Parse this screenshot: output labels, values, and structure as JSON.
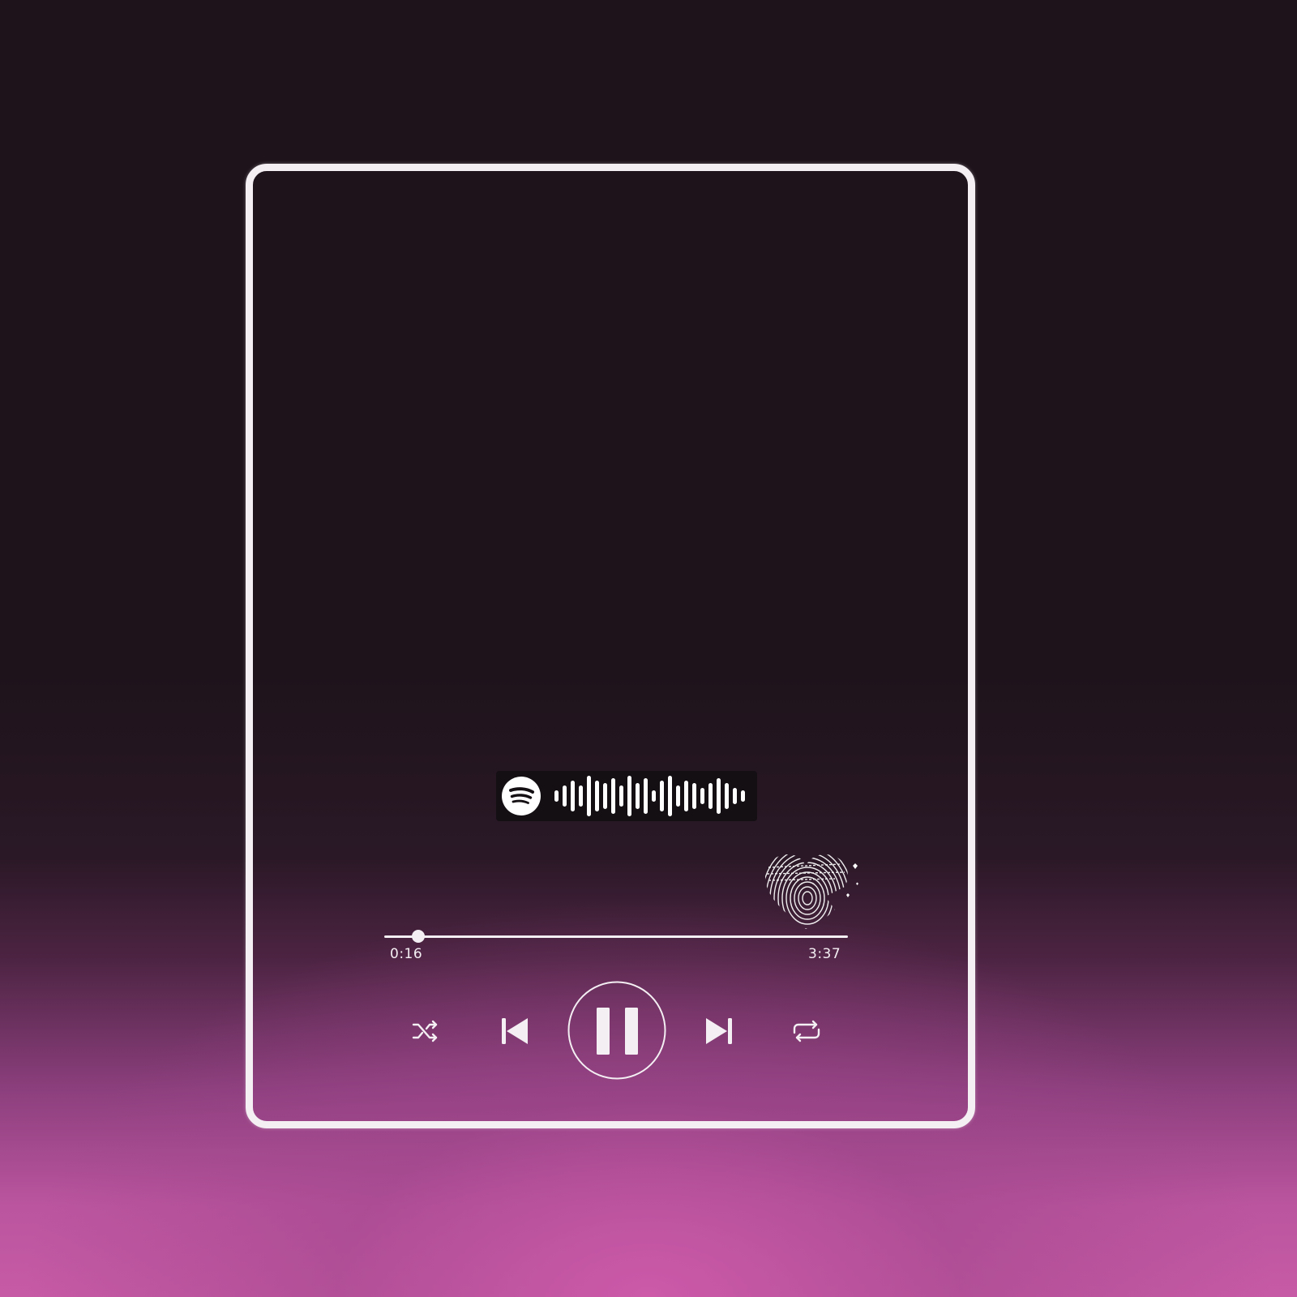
{
  "player": {
    "progress": {
      "elapsed": "0:16",
      "total": "3:37",
      "fraction": 0.074
    },
    "controls": {
      "shuffle_icon": "shuffle-icon",
      "previous_icon": "skip-previous-icon",
      "play_pause_icon": "pause-icon",
      "next_icon": "skip-next-icon",
      "repeat_icon": "repeat-icon"
    },
    "scancode": {
      "logo_icon": "spotify-logo-icon",
      "bar_levels": [
        2,
        4,
        6,
        4,
        8,
        6,
        5,
        7,
        4,
        8,
        5,
        7,
        2,
        6,
        8,
        4,
        6,
        5,
        3,
        5,
        7,
        5,
        3,
        2
      ]
    },
    "decoration_icon": "fingerprint-heart-icon"
  },
  "colors": {
    "frame": "#f4eff3",
    "background_top": "#1e131b",
    "background_bottom": "#c75aa5",
    "scancode_background": "#140f13"
  }
}
